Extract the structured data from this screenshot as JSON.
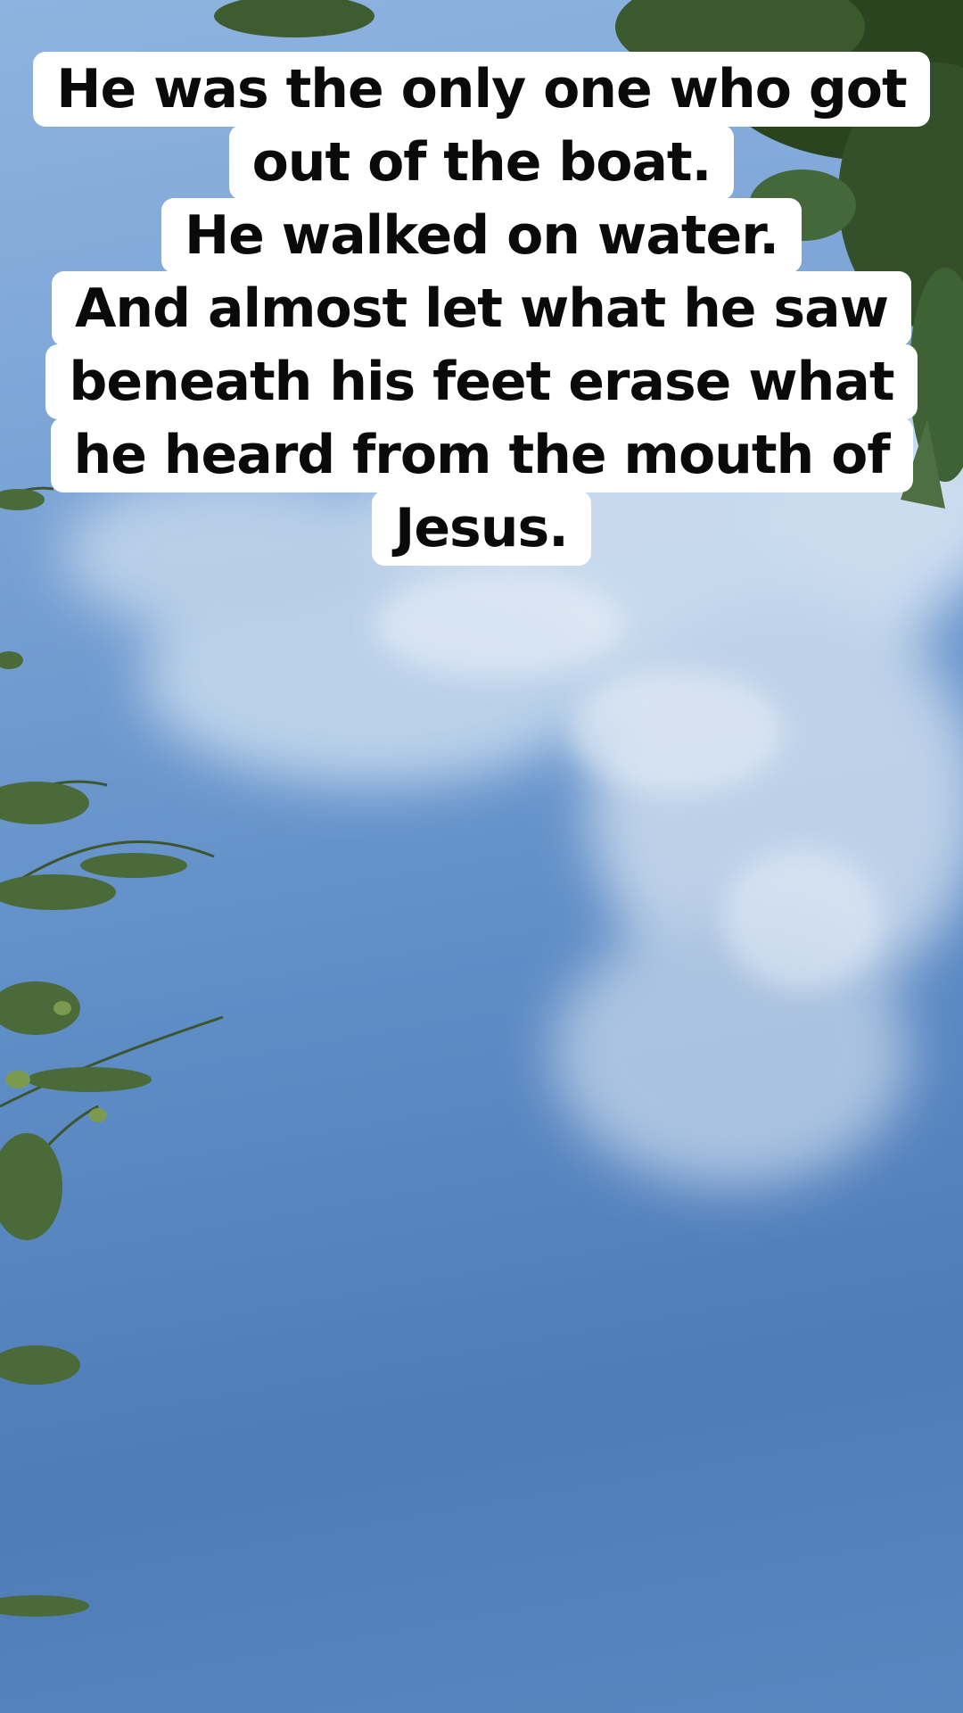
{
  "caption": {
    "lines": [
      "He was the only one who got",
      "out of the boat.",
      "He walked on water.",
      "And almost let what he saw",
      "beneath his feet erase what",
      "he heard from the mouth of",
      "Jesus."
    ]
  }
}
